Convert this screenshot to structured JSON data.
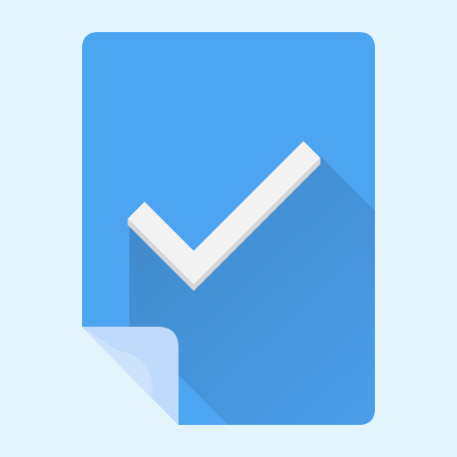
{
  "icon": {
    "name": "document-check-icon",
    "colors": {
      "background": "#E3F4FD",
      "document": "#4DA4F1",
      "document_shadow": "#3F94E3",
      "fold": "#CDE3FC",
      "fold_shade": "#B5D3F7",
      "check": "#F2F2F2",
      "check_shadow": "#3A8AD6"
    }
  }
}
